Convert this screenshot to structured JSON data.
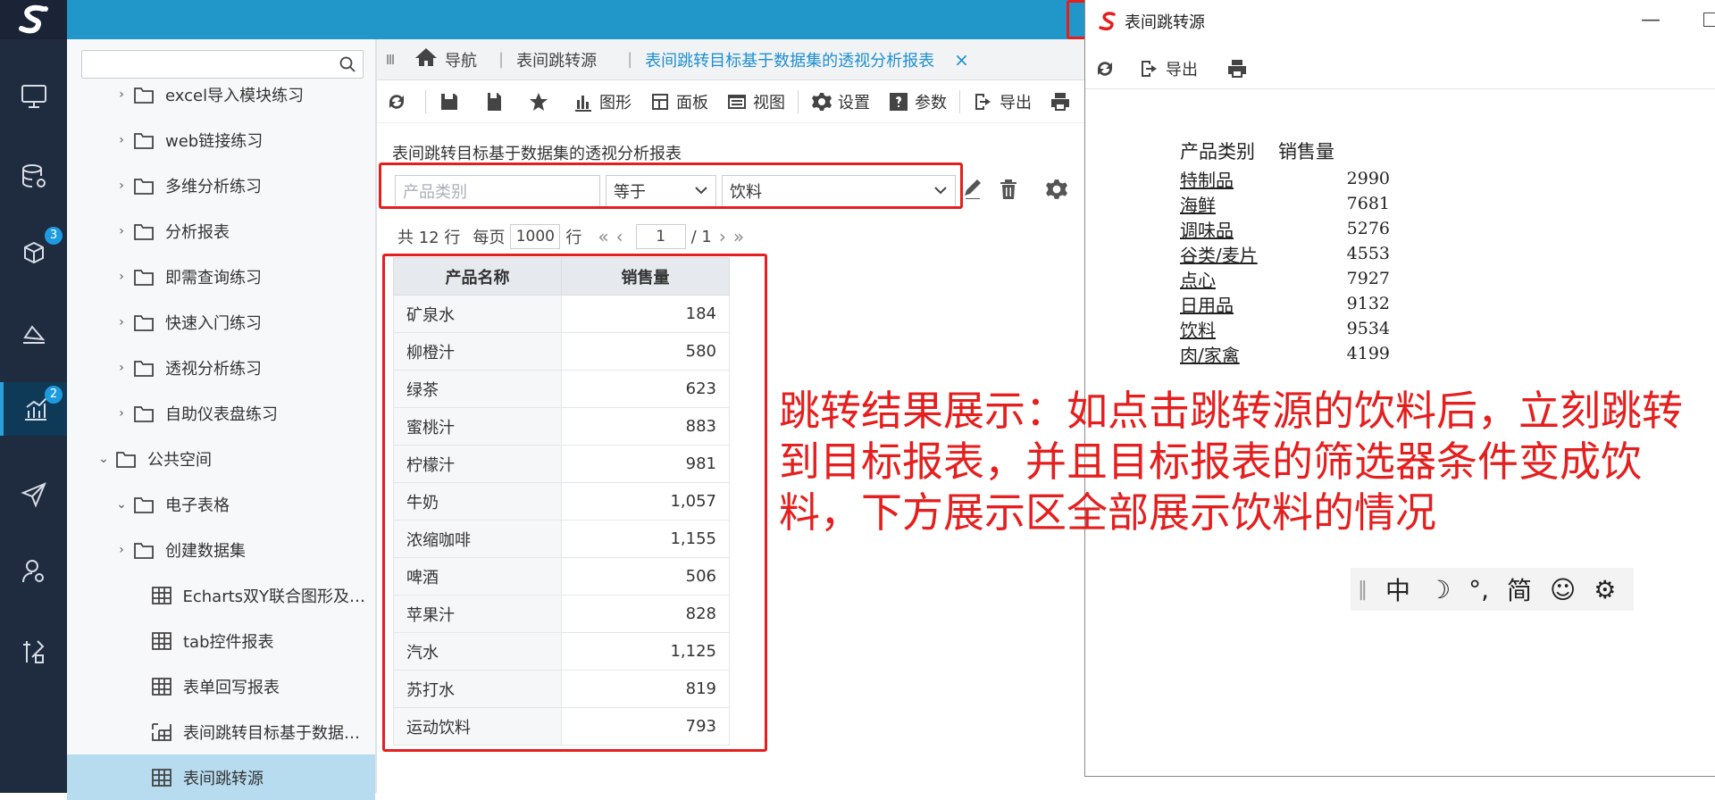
{
  "tree": {
    "search_placeholder": "",
    "items": [
      {
        "label": "excel导入模块练习",
        "type": "folder",
        "arrow": "›"
      },
      {
        "label": "web链接练习",
        "type": "folder",
        "arrow": "›"
      },
      {
        "label": "多维分析练习",
        "type": "folder",
        "arrow": "›"
      },
      {
        "label": "分析报表",
        "type": "folder",
        "arrow": "›"
      },
      {
        "label": "即需查询练习",
        "type": "folder",
        "arrow": "›"
      },
      {
        "label": "快速入门练习",
        "type": "folder",
        "arrow": "›"
      },
      {
        "label": "透视分析练习",
        "type": "folder",
        "arrow": "›"
      },
      {
        "label": "自助仪表盘练习",
        "type": "folder",
        "arrow": "›"
      },
      {
        "label": "公共空间",
        "type": "folder",
        "arrow": "⌄"
      },
      {
        "label": "电子表格",
        "type": "folder",
        "arrow": "⌄"
      },
      {
        "label": "创建数据集",
        "type": "folder",
        "arrow": "›"
      },
      {
        "label": "Echarts双Y联合图形及水...",
        "type": "table",
        "arrow": ""
      },
      {
        "label": "tab控件报表",
        "type": "table",
        "arrow": ""
      },
      {
        "label": "表单回写报表",
        "type": "table",
        "arrow": ""
      },
      {
        "label": "表间跳转目标基于数据集...",
        "type": "pivot",
        "arrow": ""
      },
      {
        "label": "表间跳转源",
        "type": "table",
        "arrow": ""
      }
    ]
  },
  "rail": {
    "badges": [
      "3",
      "2"
    ]
  },
  "tabs": {
    "home": "导航",
    "tab1": "表间跳转源",
    "tab2": "表间跳转目标基于数据集的透视分析报表"
  },
  "toolbar": {
    "graph": "图形",
    "panel": "面板",
    "view": "视图",
    "settings": "设置",
    "params": "参数",
    "export": "导出"
  },
  "report": {
    "title": "表间跳转目标基于数据集的透视分析报表",
    "filter": {
      "field_placeholder": "产品类别",
      "operator": "等于",
      "value": "饮料"
    },
    "pager": {
      "total": "共 12 行",
      "per_page_label": "每页",
      "per_page": "1000",
      "row_unit": "行",
      "page": "1",
      "total_pages": "/ 1"
    },
    "columns": [
      "产品名称",
      "销售量"
    ],
    "rows": [
      [
        "矿泉水",
        "184"
      ],
      [
        "柳橙汁",
        "580"
      ],
      [
        "绿茶",
        "623"
      ],
      [
        "蜜桃汁",
        "883"
      ],
      [
        "柠檬汁",
        "981"
      ],
      [
        "牛奶",
        "1,057"
      ],
      [
        "浓缩咖啡",
        "1,155"
      ],
      [
        "啤酒",
        "506"
      ],
      [
        "苹果汁",
        "828"
      ],
      [
        "汽水",
        "1,125"
      ],
      [
        "苏打水",
        "819"
      ],
      [
        "运动饮料",
        "793"
      ]
    ]
  },
  "annotation": "跳转结果展示：如点击跳转源的饮料后，立刻跳转到目标报表，并且目标报表的筛选器条件变成饮料，下方展示区全部展示饮料的情况",
  "popup": {
    "title": "表间跳转源",
    "export_label": "导出",
    "headers": [
      "产品类别",
      "销售量"
    ],
    "rows": [
      [
        "特制品",
        "2990"
      ],
      [
        "海鲜",
        "7681"
      ],
      [
        "调味品",
        "5276"
      ],
      [
        "谷类/麦片",
        "4553"
      ],
      [
        "点心",
        "7927"
      ],
      [
        "日用品",
        "9132"
      ],
      [
        "饮料",
        "9534"
      ],
      [
        "肉/家禽",
        "4199"
      ]
    ]
  },
  "ime": {
    "items": [
      "中",
      "☽",
      "°,",
      "简",
      "☺",
      "⚙"
    ]
  },
  "colors": {
    "header": "#2196c8",
    "rail": "#1f2b3e",
    "accent": "#1e8fd0",
    "annotation": "#e51e1e",
    "selected_row": "#b7dcef"
  }
}
